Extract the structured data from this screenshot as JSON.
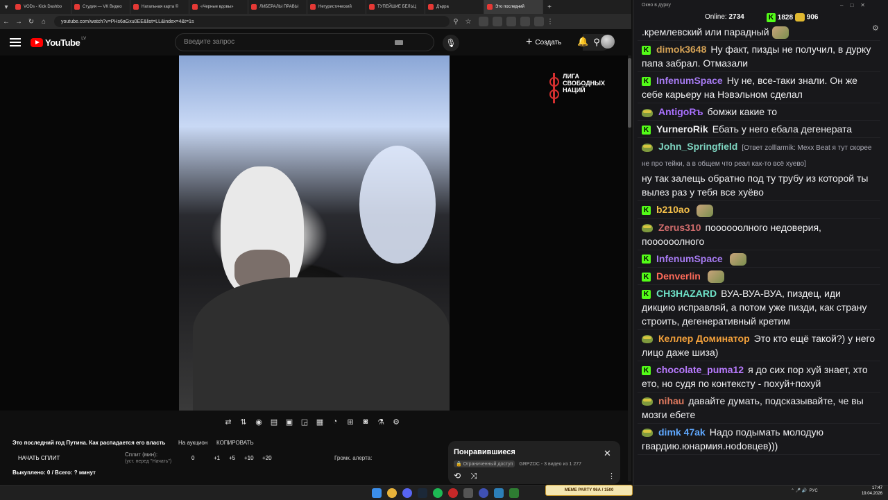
{
  "browser": {
    "tabs": [
      {
        "label": "VODs - Kick Dashbo",
        "active": false
      },
      {
        "label": "Студия — VK Видео",
        "active": false
      },
      {
        "label": "Натальная карта ©",
        "active": false
      },
      {
        "label": "«Черные вдовы»",
        "active": false
      },
      {
        "label": "ЛИБЕРАЛЫ ПРАВЫ",
        "active": false
      },
      {
        "label": "Нетуристический",
        "active": false
      },
      {
        "label": "ТУПЕЙШИЕ БЕЛЬЦ",
        "active": false
      },
      {
        "label": "Дърра",
        "active": false
      },
      {
        "label": "Это последний",
        "active": true
      }
    ],
    "url": "youtube.com/watch?v=PHs6aGxu0EE&list=LL&index=4&t=1s"
  },
  "youtube": {
    "logo_text": "YouTube",
    "region": "LV",
    "search_placeholder": "Введите запрос",
    "create_label": "Создать"
  },
  "video": {
    "watermark_text": [
      "ЛИГА",
      "СВОБОДНЫХ",
      "НАЦИЙ"
    ]
  },
  "overlay_panel": {
    "title": "Это последний год Путина. Как распадается его власть",
    "auction_label": "На аукцион",
    "copy_label": "КОПИРОВАТЬ",
    "split_button": "НАЧАТЬ СПЛИТ",
    "split_label": "Сплит (мин):",
    "split_hint": "(уст. перед \"Начать\")",
    "split_value": "0",
    "increments": [
      "+1",
      "+5",
      "+10",
      "+20"
    ],
    "volume_label": "Громк. алерта:",
    "bought": "Выкуплено: 0 / Всего: ? минут"
  },
  "liked_popup": {
    "title": "Понравившиеся",
    "access": "Ограниченный доступ",
    "meta": "GRPZDC - 3 видео из 1 277"
  },
  "chat": {
    "window_title": "Окно в дурку",
    "online_label": "Online:",
    "online_count": "2734",
    "kick_count": "1828",
    "gold_count": "906",
    "messages": [
      {
        "user": "",
        "text": ".кремлевский или парадный",
        "color": "#ffffff",
        "badge": "none",
        "reply": "",
        "emote": true
      },
      {
        "user": "dimok3648",
        "text": "Ну факт, пизды не получил, в дурку папа забрал. Отмазали",
        "color": "#d6a356",
        "badge": "kick",
        "reply": "",
        "emote": false
      },
      {
        "user": "InfenumSpace",
        "text": "Ну не, все-таки знали. Он же себе карьеру на Нэвэльном сделал",
        "color": "#a77bf3",
        "badge": "kick",
        "reply": "",
        "emote": false
      },
      {
        "user": "AntigoRъ",
        "text": "бомжи какие то",
        "color": "#a970ff",
        "badge": "pepe",
        "reply": "",
        "emote": false
      },
      {
        "user": "YurneroRik",
        "text": "Ебать у него ебала дегенерата",
        "color": "#efeff1",
        "badge": "kick",
        "reply": "",
        "emote": false
      },
      {
        "user": "John_Springfield",
        "text": "ну так залещь обратно под ту трубу из которой ты вылез раз у тебя все хуёво",
        "color": "#7fd6c2",
        "badge": "pepe",
        "reply": "[Ответ zolllarmik: Mexx Beat я тут скорее не про тейки, а в общем что реал как-то всё хуево]",
        "emote": false
      },
      {
        "user": "b210ao",
        "text": "",
        "color": "#f5c04a",
        "badge": "kick",
        "reply": "",
        "emote": true
      },
      {
        "user": "Zerus310",
        "text": "поооооолного недоверия, поооооолного",
        "color": "#d26d6d",
        "badge": "pepe",
        "reply": "",
        "emote": false
      },
      {
        "user": "InfenumSpace",
        "text": "",
        "color": "#a77bf3",
        "badge": "kick",
        "reply": "",
        "emote": true
      },
      {
        "user": "Denverlin",
        "text": "",
        "color": "#ff6b5a",
        "badge": "kick",
        "reply": "",
        "emote": true
      },
      {
        "user": "CH3HAZARD",
        "text": "ВУА-ВУА-ВУА, пиздец, иди дикцию исправляй, а потом уже пизди, как страну строить, дегенеративный кретим",
        "color": "#6fe3c9",
        "badge": "kick",
        "reply": "",
        "emote": false
      },
      {
        "user": "Келлер Доминатор",
        "text": "Это кто ещё такой?) у него лицо даже шиза)",
        "color": "#f2a03b",
        "badge": "pepe",
        "reply": "",
        "emote": false
      },
      {
        "user": "chocolate_puma12",
        "text": "я до сих пор хуй знает, хто ето, но судя по контексту - похуй+похуй",
        "color": "#b97bff",
        "badge": "kick",
        "reply": "",
        "emote": false
      },
      {
        "user": "nihau",
        "text": "давайте думать, подсказывайте, че вы мозги ебете",
        "color": "#e07a5f",
        "badge": "pepe",
        "reply": "",
        "emote": false
      },
      {
        "user": "dimk 47ak",
        "text": "Надо подымать молодую гвардию.юнармия.ноdовцев)))",
        "color": "#5fa8ff",
        "badge": "pepe",
        "reply": "",
        "emote": false
      }
    ]
  },
  "taskbar": {
    "badge_title": "MEME PARTY",
    "badge_progress": "96А / 1500",
    "tray_lang": "РУС",
    "time": "17:47",
    "date": "19.04.2026"
  }
}
